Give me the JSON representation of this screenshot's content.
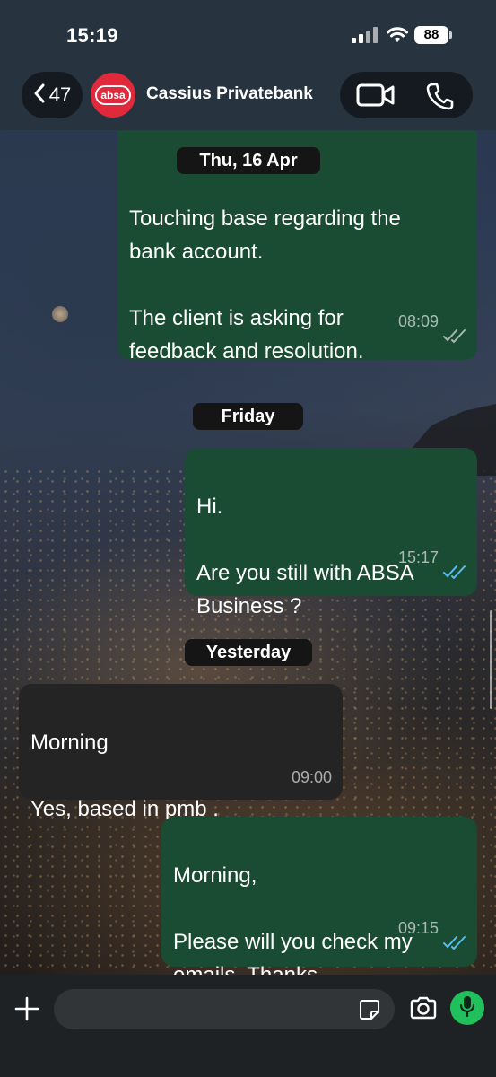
{
  "status_bar": {
    "time": "15:19",
    "battery": "88"
  },
  "header": {
    "back_count": "47",
    "avatar_text": "absa",
    "contact_name": "Cassius Privatebank"
  },
  "day_labels": {
    "thu": "Thu, 16 Apr",
    "friday": "Friday",
    "yesterday": "Yesterday"
  },
  "messages": [
    {
      "direction": "out",
      "text": "Touching base regarding the\nbank account.\n\nThe client is asking for\nfeedback and resolution.",
      "time": "08:09",
      "read": false
    },
    {
      "direction": "out",
      "text": "Hi.\n\nAre you still with ABSA\nBusiness ?",
      "time": "15:17",
      "read": true
    },
    {
      "direction": "in",
      "text": "Morning\n\nYes, based in pmb .",
      "time": "09:00"
    },
    {
      "direction": "out",
      "text": "Morning,\n\nPlease will you check my\nemails. Thanks.",
      "time": "09:15",
      "read": true
    }
  ],
  "colors": {
    "outgoing_bubble": "#1a4b33",
    "incoming_bubble": "#242424",
    "read_ticks": "#53bdeb",
    "mic_button": "#20c05c",
    "avatar": "#e02a3c"
  },
  "input": {
    "placeholder": ""
  },
  "icons": [
    "chevron-left-icon",
    "video-call-icon",
    "phone-icon",
    "plus-icon",
    "sticker-icon",
    "camera-icon",
    "microphone-icon"
  ]
}
